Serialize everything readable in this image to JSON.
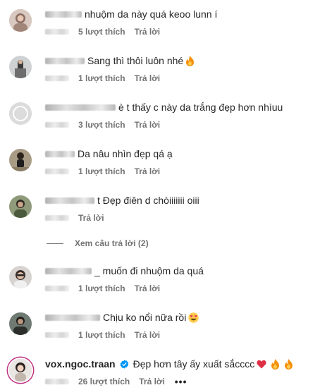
{
  "comments": [
    {
      "text": "nhuộm da này quá keoo lunn í",
      "likes": "5 lượt thích",
      "reply": "Trả lời",
      "emoji": ""
    },
    {
      "text": "Sang thì thôi luôn nhé",
      "likes": "1 lượt thích",
      "reply": "Trả lời",
      "emoji": "fire"
    },
    {
      "text": "è t thấy c này da trắng đẹp hơn nhìuu",
      "likes": "3 lượt thích",
      "reply": "Trả lời",
      "emoji": ""
    },
    {
      "text": "Da nâu nhìn đẹp qá ạ",
      "likes": "1 lượt thích",
      "reply": "Trả lời",
      "emoji": ""
    },
    {
      "text": "t Đẹp điên d chòiiiiiii oiii",
      "likes": "",
      "reply": "Trả lời",
      "emoji": ""
    },
    {
      "text": "_ muốn đi nhuộm da quá",
      "likes": "1 lượt thích",
      "reply": "Trả lời",
      "emoji": ""
    },
    {
      "text": "Chịu ko nổi nữa rồi",
      "likes": "1 lượt thích",
      "reply": "Trả lời",
      "emoji": "grin-hearts"
    },
    {
      "username": "vox.ngoc.traan",
      "text": "Đẹp hơn tây ấy xuất sắcccc",
      "likes": "26 lượt thích",
      "reply": "Trả lời",
      "more": "•••",
      "emoji": "heart-fire-fire"
    }
  ],
  "view_replies": "Xem câu trả lời (2)",
  "colors": {
    "text": "#262626",
    "meta": "#737373",
    "verified": "#0095f6",
    "story_ring": "#c13584"
  }
}
